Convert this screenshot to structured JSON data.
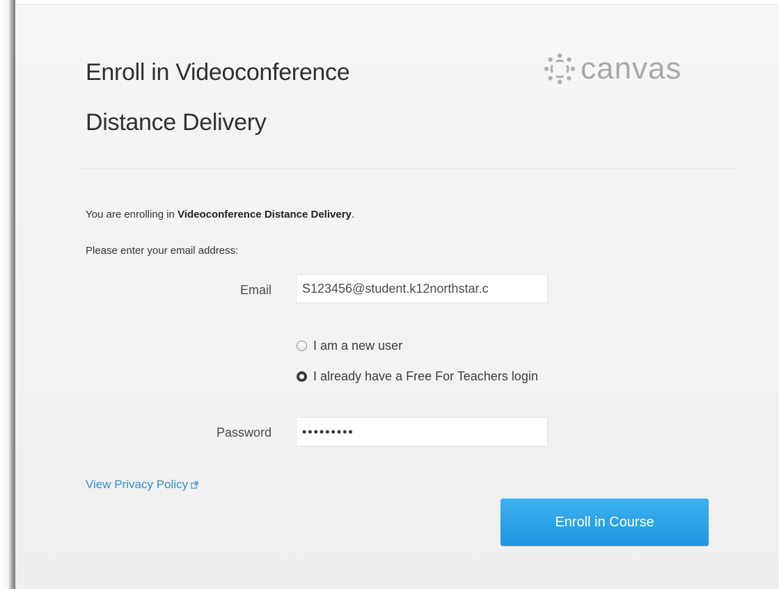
{
  "header": {
    "title_line1": "Enroll in Videoconference",
    "title_line2": "Distance Delivery",
    "logo_text": "canvas",
    "logo_icon": "canvas-logo-icon"
  },
  "form": {
    "intro_prefix": "You are enrolling in ",
    "intro_course": "Videoconference Distance Delivery",
    "intro_suffix": ".",
    "email_prompt": "Please enter your email address:",
    "email_label": "Email",
    "email_value": "S123456@student.k12northstar.c",
    "radio_options": [
      {
        "label": "I am a new user",
        "selected": false
      },
      {
        "label": "I already have a Free For Teachers login",
        "selected": true
      }
    ],
    "password_label": "Password",
    "password_value": "•••••••••"
  },
  "footer": {
    "privacy_link": "View Privacy Policy",
    "privacy_icon": "external-link-icon",
    "enroll_button": "Enroll in Course"
  },
  "colors": {
    "accent": "#1b96e0",
    "link": "#3b8dc0",
    "logo": "#a9a9a9"
  }
}
